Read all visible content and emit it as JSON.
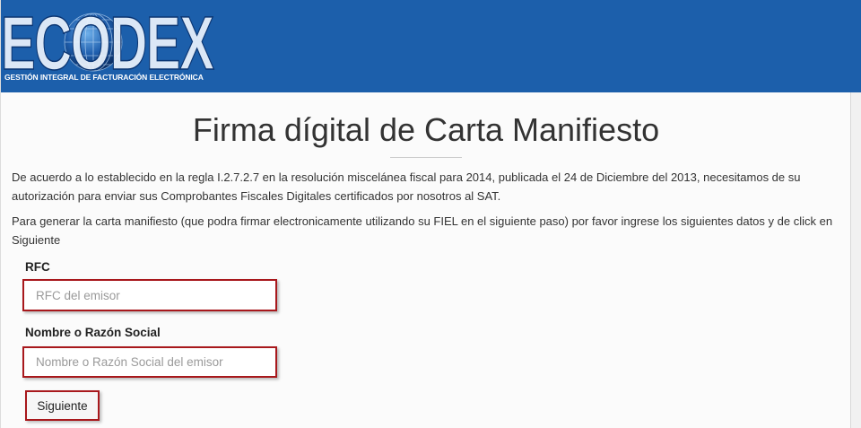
{
  "header": {
    "logo_text": "ECODEX",
    "logo_subtitle": "GESTIÓN INTEGRAL DE FACTURACIÓN ELECTRÓNICA"
  },
  "page": {
    "title": "Firma dígital de Carta Manifiesto",
    "intro_paragraphs": [
      "De acuerdo a lo establecido en la regla I.2.7.2.7 en la resolución miscelánea fiscal para 2014, publicada el 24 de Diciembre del 2013, necesitamos de su autorización para enviar sus Comprobantes Fiscales Digitales certificados por nosotros al SAT.",
      "Para generar la carta manifiesto (que podra firmar electronicamente utilizando su FIEL en el siguiente paso) por favor ingrese los siguientes datos y de click en Siguiente"
    ]
  },
  "form": {
    "rfc": {
      "label": "RFC",
      "placeholder": "RFC del emisor"
    },
    "name": {
      "label": "Nombre o Razón Social",
      "placeholder": "Nombre o Razón Social del emisor"
    },
    "submit_label": "Siguiente"
  },
  "colors": {
    "header_bg": "#1c5fab",
    "highlight_border": "#a8181c",
    "text": "#333333"
  }
}
